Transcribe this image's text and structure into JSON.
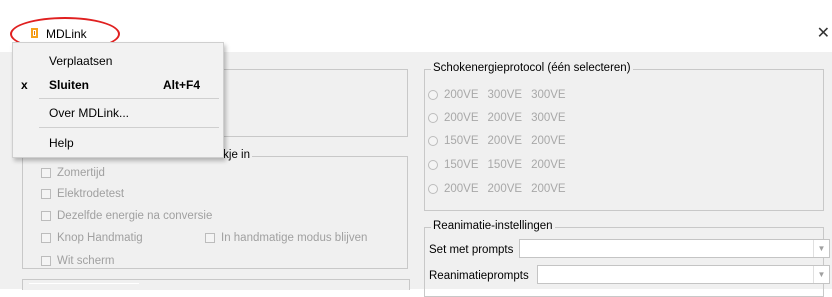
{
  "window": {
    "title": "MDLink",
    "close_glyph": "✕",
    "icon": "mdlink-app-icon",
    "highlight_color": "#e02020"
  },
  "system_menu": {
    "items": [
      {
        "mark": "",
        "label": "Verplaatsen",
        "accel": ""
      },
      {
        "mark": "x",
        "label": "Sluiten",
        "accel": "Alt+F4"
      },
      {
        "mark": "",
        "label": "Over MDLink...",
        "accel": ""
      },
      {
        "mark": "",
        "label": "Help",
        "accel": ""
      }
    ]
  },
  "left_group": {
    "title_visible": "vakje in",
    "checkboxes": [
      {
        "label": "Zomertijd",
        "checked": false
      },
      {
        "label": "Elektrodetest",
        "checked": false
      },
      {
        "label": "Dezelfde energie na conversie",
        "checked": false
      },
      {
        "label": "Knop Handmatig",
        "checked": false
      },
      {
        "label": "In handmatige modus blijven",
        "checked": false
      },
      {
        "label": "Wit scherm",
        "checked": false
      }
    ]
  },
  "shock_group": {
    "title": "Schokenergieprotocol (één selecteren)",
    "options": [
      [
        "200VE",
        "300VE",
        "300VE"
      ],
      [
        "200VE",
        "200VE",
        "300VE"
      ],
      [
        "150VE",
        "200VE",
        "200VE"
      ],
      [
        "150VE",
        "150VE",
        "200VE"
      ],
      [
        "200VE",
        "200VE",
        "200VE"
      ]
    ]
  },
  "reanimation_group": {
    "title": "Reanimatie-instellingen",
    "set_label": "Set met prompts",
    "prompts_label": "Reanimatieprompts",
    "set_value": "",
    "prompts_value": ""
  }
}
